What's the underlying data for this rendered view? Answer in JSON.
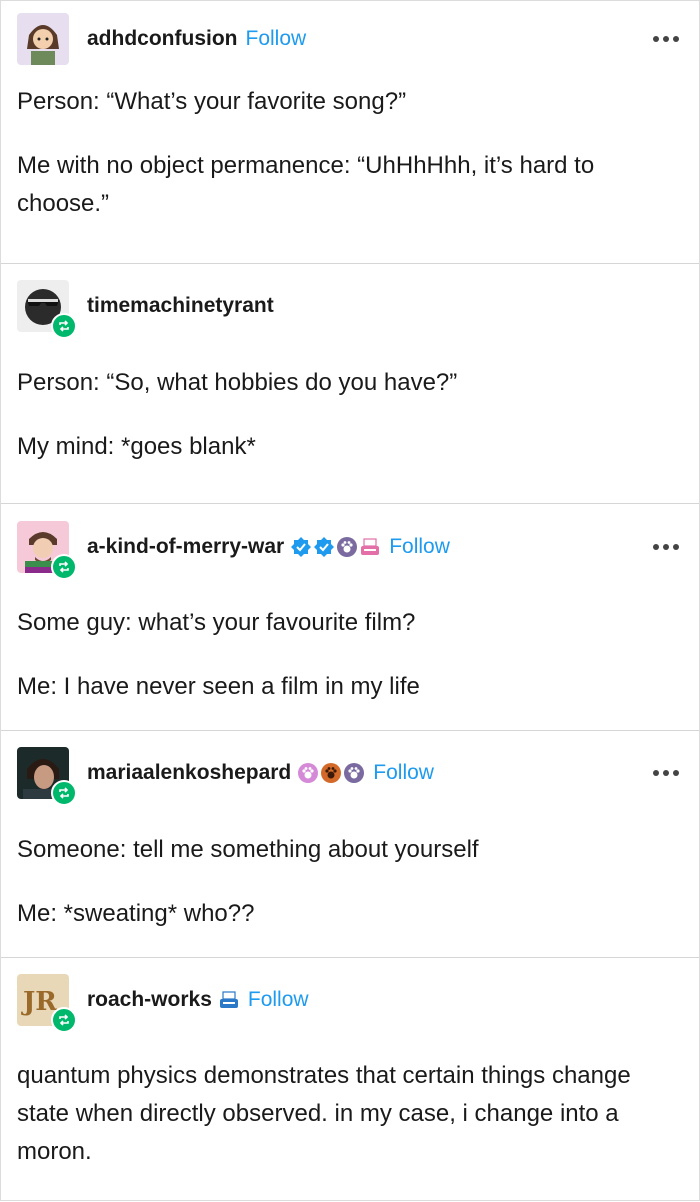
{
  "posts": [
    {
      "username": "adhdconfusion",
      "follow": "Follow",
      "avatar": "girl-avatar",
      "paragraphs": [
        "Person: “What’s your favorite song?”",
        "Me with no object permanence: “UhHhHhh, it’s hard to choose.”"
      ]
    },
    {
      "username": "timemachinetyrant",
      "avatar": "sunglasses-avatar",
      "reblogged": true,
      "paragraphs": [
        "Person: “So, what hobbies do you have?”",
        "My mind: *goes blank*"
      ]
    },
    {
      "username": "a-kind-of-merry-war",
      "follow": "Follow",
      "avatar": "drawn-man-avatar",
      "reblogged": true,
      "badges": [
        "verified-badge",
        "verified-badge",
        "paw-badge",
        "typewriter-badge"
      ],
      "paragraphs": [
        "Some guy: what’s your favourite film?",
        "Me: I have never seen a film in my life"
      ]
    },
    {
      "username": "mariaalenkoshepard",
      "follow": "Follow",
      "avatar": "game-character-avatar",
      "reblogged": true,
      "badges": [
        "paw-badge",
        "paw-badge",
        "paw-badge"
      ],
      "paragraphs": [
        "Someone: tell me something about yourself",
        "Me: *sweating* who??"
      ]
    },
    {
      "username": "roach-works",
      "follow": "Follow",
      "avatar": "jr-logo-avatar",
      "reblogged": true,
      "badges": [
        "typewriter-badge"
      ],
      "paragraphs": [
        "quantum physics demonstrates that certain things change state when directly observed. in my case, i change into a moron."
      ]
    }
  ],
  "colors": {
    "follow": "#1e9bef",
    "reblog_badge": "#00b86b",
    "divider": "#d6d6d6"
  }
}
